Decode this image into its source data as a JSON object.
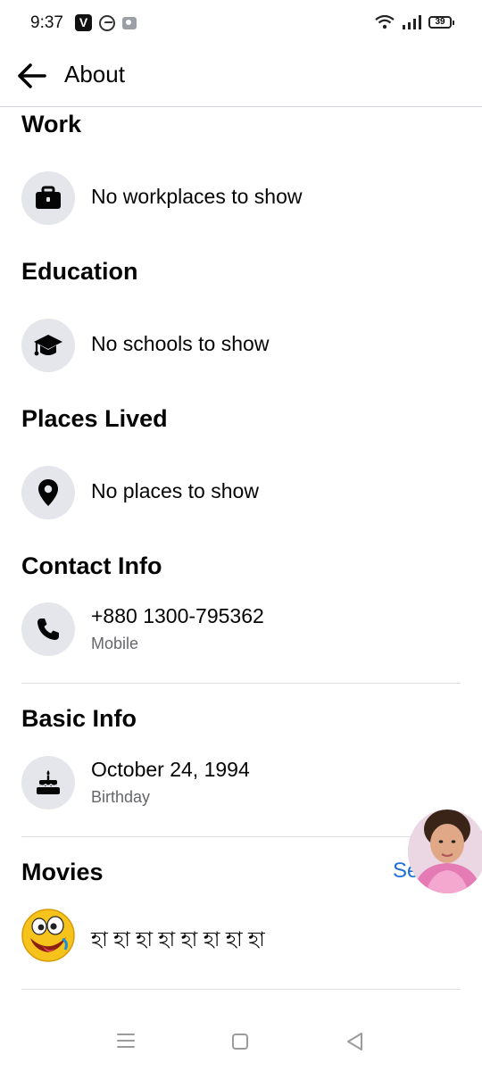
{
  "status_bar": {
    "time": "9:37",
    "battery": "39"
  },
  "header": {
    "title": "About",
    "back_icon": "back-arrow-icon"
  },
  "work": {
    "title": "Work",
    "text": "No workplaces to show",
    "icon": "briefcase-icon"
  },
  "education": {
    "title": "Education",
    "text": "No schools to show",
    "icon": "graduation-cap-icon"
  },
  "places": {
    "title": "Places Lived",
    "text": "No places to show",
    "icon": "location-pin-icon"
  },
  "contact": {
    "title": "Contact Info",
    "value": "+880 1300-795362",
    "label": "Mobile",
    "icon": "phone-icon"
  },
  "basic": {
    "title": "Basic Info",
    "value": "October 24, 1994",
    "label": "Birthday",
    "icon": "birthday-cake-icon"
  },
  "movies": {
    "title": "Movies",
    "see_all": "Se",
    "item": "হা হা হা হা হা হা হা হা",
    "icon": "laughing-emoji-icon"
  },
  "colors": {
    "accent": "#216fdb",
    "text": "#050505",
    "secondary": "#65676b",
    "icon_bg": "#e4e6eb"
  }
}
